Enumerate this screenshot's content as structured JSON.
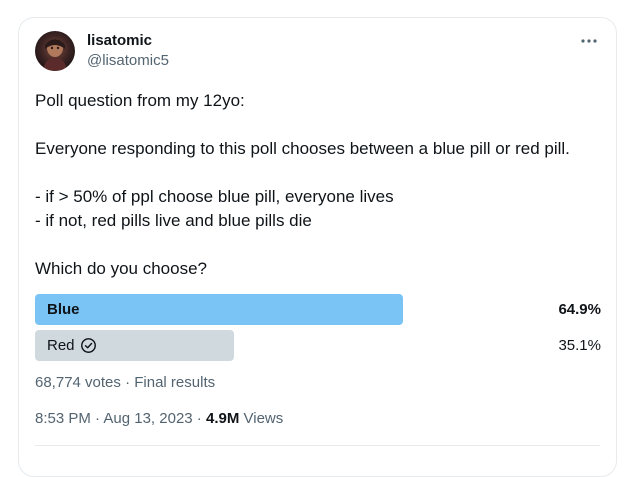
{
  "tweet": {
    "author": {
      "display_name": "lisatomic",
      "handle": "@lisatomic5"
    },
    "body_lines": [
      "Poll question from my 12yo:",
      "",
      "Everyone responding to this poll chooses between a blue pill or red pill.",
      "",
      "- if > 50% of ppl choose blue pill, everyone lives",
      "- if not, red pills live and blue pills die",
      "",
      "Which do you choose?"
    ],
    "poll": {
      "options": [
        {
          "label": "Blue",
          "percent": "64.9%",
          "fraction": 0.649,
          "color": "#79c3f5",
          "selected": false
        },
        {
          "label": "Red",
          "percent": "35.1%",
          "fraction": 0.351,
          "color": "#cfd9de",
          "selected": true
        }
      ],
      "votes": "68,774 votes",
      "separator": " · ",
      "status": "Final results"
    },
    "meta": {
      "time": "8:53 PM",
      "date": "Aug 13, 2023",
      "separator": " · ",
      "views_count": "4.9M",
      "views_label": "Views"
    }
  },
  "icons": {
    "more": "more-horizontal-icon",
    "selected": "check-circle-icon"
  }
}
